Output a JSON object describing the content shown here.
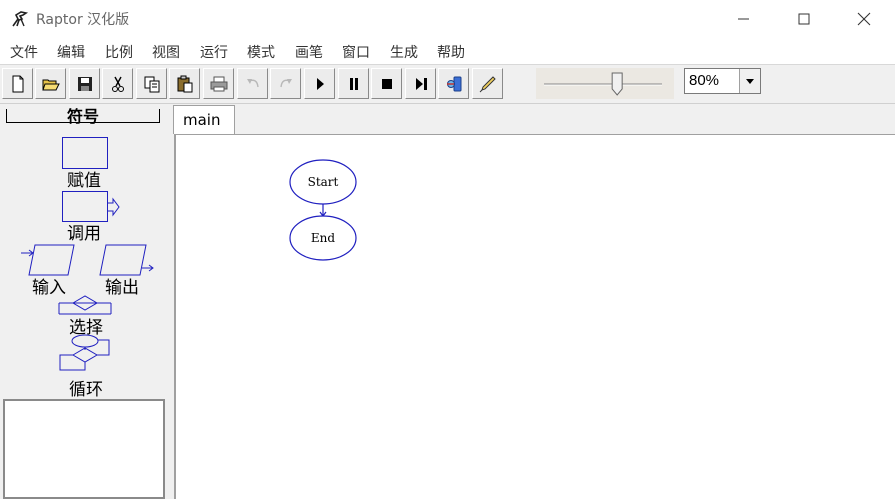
{
  "window": {
    "title": "Raptor 汉化版"
  },
  "menu": {
    "items": [
      "文件",
      "编辑",
      "比例",
      "视图",
      "运行",
      "模式",
      "画笔",
      "窗口",
      "生成",
      "帮助"
    ]
  },
  "toolbar": {
    "buttons": [
      {
        "icon": "new-file-icon"
      },
      {
        "icon": "open-folder-icon"
      },
      {
        "icon": "save-icon"
      },
      {
        "icon": "cut-icon"
      },
      {
        "icon": "copy-icon"
      },
      {
        "icon": "paste-icon"
      },
      {
        "icon": "print-icon"
      },
      {
        "icon": "undo-icon"
      },
      {
        "icon": "redo-icon"
      },
      {
        "icon": "play-icon"
      },
      {
        "icon": "pause-icon"
      },
      {
        "icon": "stop-icon"
      },
      {
        "icon": "step-icon"
      },
      {
        "icon": "test-server-icon"
      },
      {
        "icon": "pen-icon"
      }
    ],
    "speed_slider_level": 0.62,
    "zoom": "80%"
  },
  "symbols": {
    "title": "符号",
    "assignment": "赋值",
    "call": "调用",
    "input": "输入",
    "output": "输出",
    "selection": "选择",
    "loop": "循环"
  },
  "tabs": {
    "main": "main"
  },
  "flowchart": {
    "start": "Start",
    "end": "End",
    "line_color": "#2020c0"
  }
}
